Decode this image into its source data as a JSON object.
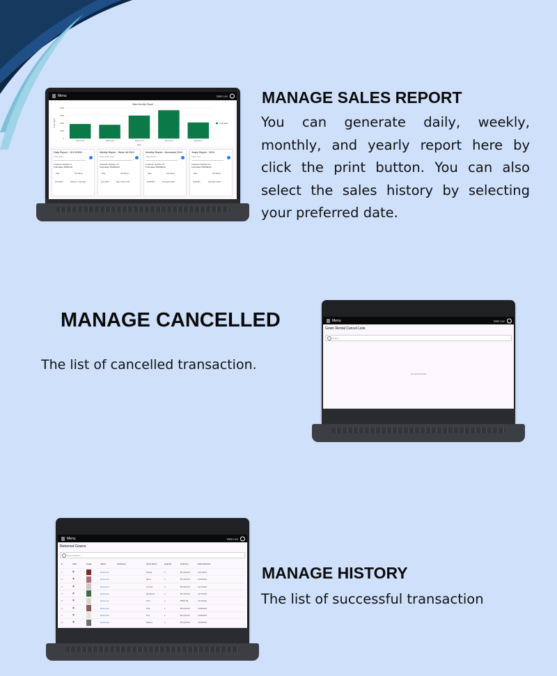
{
  "colors": {
    "background": "#cfe0fb",
    "bar": "#0b7a48",
    "screen": "#fbf7fd",
    "laptop": "#3c3e43",
    "link": "#2a7de1"
  },
  "sales_section": {
    "heading": "MANAGE SALES REPORT",
    "description": "You can generate daily, weekly, monthly, and yearly report here by click the print button. You can also select the sales history by selecting your preferred date."
  },
  "cancelled_section": {
    "heading": "MANAGE CANCELLED",
    "description": "The list of cancelled transaction."
  },
  "history_section": {
    "heading": "MANAGE HISTORY",
    "description": "The list of successful transaction"
  },
  "app": {
    "menu_label": "Menu",
    "user_name": "Gelo Lee",
    "avatar_icon": "user-circle-icon",
    "menu_icon": "hamburger-icon"
  },
  "sales_app": {
    "chart_data": {
      "type": "bar",
      "title": "Sales Monthly Report",
      "ylabel": "Total Sales",
      "xlabel": "Date",
      "ylim": [
        0,
        4000
      ],
      "yticks": [
        "4000",
        "3000",
        "2000",
        "1000",
        "0"
      ],
      "categories": [
        "2024-11-06",
        "2024-11-08",
        "2024-11-10",
        "2024-11-12",
        "2024-11-13"
      ],
      "series": [
        {
          "name": "Total Sales",
          "values": [
            1900,
            1800,
            3000,
            3700,
            2100
          ]
        }
      ],
      "legend_position": "right"
    },
    "cards": [
      {
        "title": "Daily Report - 11/13/2024",
        "select": "Select Date",
        "customers": "Customer Number: 3",
        "total": "Total Sales: ₱6000.00",
        "col1": "Date",
        "col2": "Full Name",
        "row1": "11/13/2024",
        "row2": "Dolores G. Jolenbag",
        "print_icon": "print-icon"
      },
      {
        "title": "Weekly Report - Week 46 2024",
        "select": "Select Week Date",
        "customers": "Customer Number: 11",
        "total": "Total Sales: ₱16500.00",
        "col1": "Date",
        "col2": "Full Name",
        "row1": "11/11/2024",
        "row2": "Mary Christ Corde",
        "print_icon": "print-icon"
      },
      {
        "title": "Monthly Report - November 2024",
        "select": "Select Month",
        "customers": "Customer Number: 21",
        "total": "Total Sales: ₱29180.00",
        "col1": "Date",
        "col2": "Full Name",
        "row1": "11/08/2024",
        "row2": "Recorado Lulidel",
        "print_icon": "print-icon"
      },
      {
        "title": "Yearly Report - 2024",
        "select": "Select Year",
        "customers": "Customer Number: 21",
        "total": "Total Sales: ₱29180.00",
        "col1": "Date",
        "col2": "Full Name",
        "row1": "11/8/2024",
        "row2": "Recorado Lulidel",
        "print_icon": "print-icon"
      }
    ]
  },
  "cancel_app": {
    "title": "Gown Rental Cancel Lists",
    "search_placeholder": "Search",
    "empty_message": "No Cancel found"
  },
  "history_app": {
    "title": "Returned Gowns",
    "search_placeholder": "Search History",
    "columns": [
      "#",
      "View",
      "Image",
      "Status",
      "Full Name",
      "Gown Name",
      "Quantity",
      "Total Fee",
      "Date Returned"
    ],
    "rows": [
      {
        "n": "1",
        "status": "Returned",
        "name": "",
        "gown": "Shelia",
        "qty": "1",
        "fee": "₱1,000.00",
        "date": "11/1/2024",
        "img": "#7b2a2a"
      },
      {
        "n": "2",
        "status": "Returned",
        "name": "",
        "gown": "Elina",
        "qty": "1",
        "fee": "₱1,000.00",
        "date": "11/6/2024",
        "img": "#b06a7a"
      },
      {
        "n": "3",
        "status": "Returned",
        "name": "",
        "gown": "Lumira",
        "qty": "1",
        "fee": "₱1,000.00",
        "date": "11/7/2024",
        "img": "#cfc8c0"
      },
      {
        "n": "4",
        "status": "Returned",
        "name": "",
        "gown": "Elizabeth",
        "qty": "1",
        "fee": "₱1,500.00",
        "date": "11/7/2024",
        "img": "#3f6b4a"
      },
      {
        "n": "5",
        "status": "Returned",
        "name": "",
        "gown": "Nari",
        "qty": "1",
        "fee": "₱800.00",
        "date": "11/7/2024",
        "img": "#dbd6cc"
      },
      {
        "n": "6",
        "status": "Returned",
        "name": "",
        "gown": "Pria",
        "qty": "1",
        "fee": "₱1,000.00",
        "date": "11/8/2024",
        "img": "#8a5a5a"
      },
      {
        "n": "7",
        "status": "Returned",
        "name": "",
        "gown": "Prin",
        "qty": "1",
        "fee": "₱1,000.00",
        "date": "11/8/2024",
        "img": "#e9e4da"
      },
      {
        "n": "8",
        "status": "Returned",
        "name": "",
        "gown": "Matina",
        "qty": "1",
        "fee": "₱1,000.00",
        "date": "11/8/2024",
        "img": "#6d6f73"
      }
    ]
  }
}
